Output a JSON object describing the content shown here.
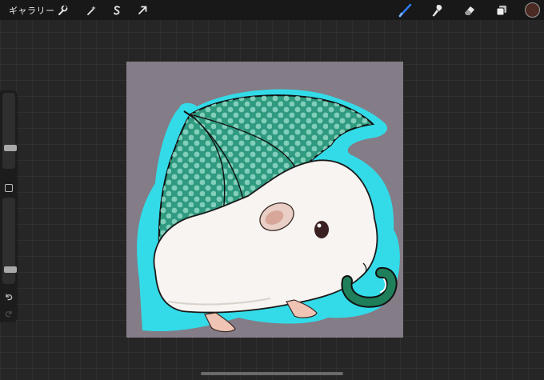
{
  "topbar": {
    "gallery_label": "ギャラリー",
    "left_tools": [
      "wrench-icon",
      "magic-wand-icon",
      "selection-s-icon",
      "transform-arrow-icon"
    ],
    "right_tools": [
      "brush-icon",
      "smudge-icon",
      "eraser-icon",
      "layers-icon"
    ],
    "active_tool": "brush-icon",
    "active_color": "#4a2a22"
  },
  "sidebar": {
    "brush_size": 0.25,
    "brush_opacity": 0.14
  },
  "canvas": {
    "background_color": "#847c86",
    "outline_color": "#33dbe8",
    "umbrella_color": "#2f9a7f"
  }
}
